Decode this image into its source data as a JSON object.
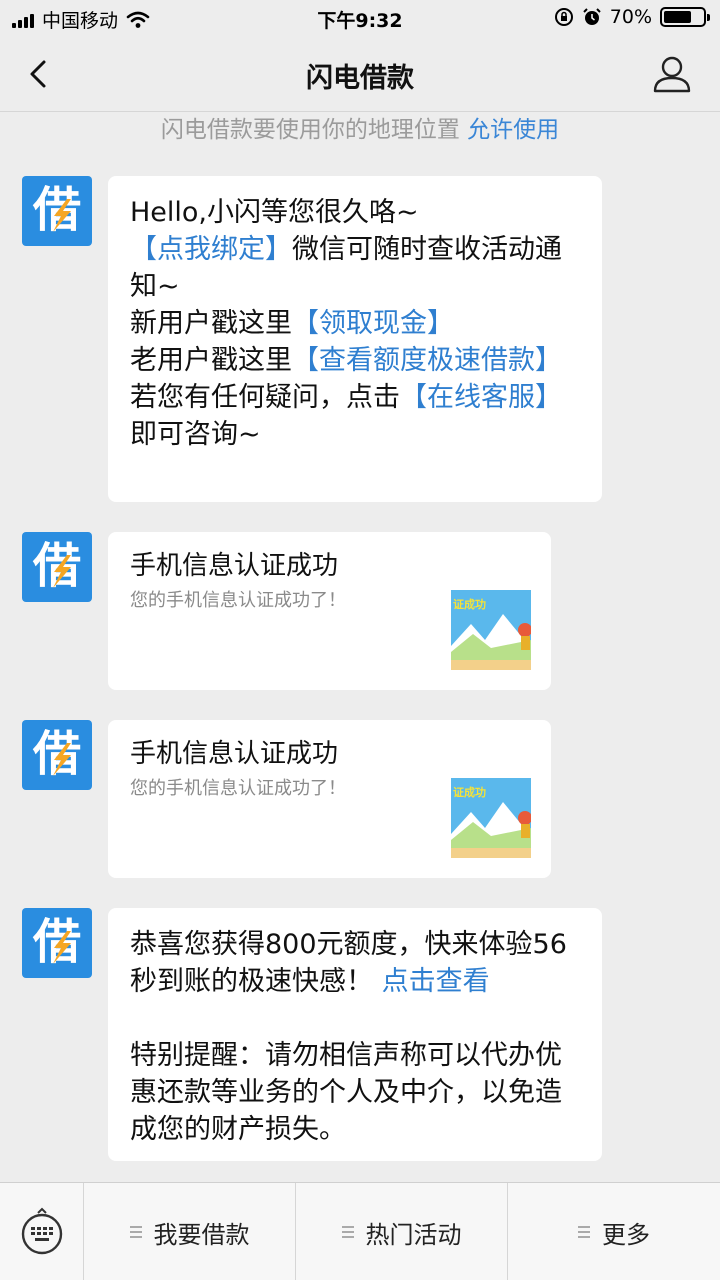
{
  "status_bar": {
    "carrier": "中国移动",
    "time": "下午9:32",
    "battery_percent": "70%",
    "battery_level": 0.7
  },
  "nav": {
    "title": "闪电借款",
    "back_icon": "chevron-left-icon",
    "user_icon": "user-profile-icon"
  },
  "location_tip": {
    "text": "闪电借款要使用你的地理位置",
    "action": "允许使用"
  },
  "avatar": {
    "char": "借",
    "color": "#2a8de0",
    "accent": "#f5a623"
  },
  "messages": {
    "welcome": {
      "line1": "Hello,小闪等您很久咯~",
      "link1": "【点我绑定】",
      "text1": "微信可随时查收活动通知~",
      "text2": "新用户戳这里",
      "link2": "【领取现金】",
      "text3": "老用户戳这里",
      "link3": "【查看额度极速借款】",
      "text4": "若您有任何疑问，点击",
      "link4": "【在线客服】",
      "text5": "即可咨询~"
    },
    "card1": {
      "title": "手机信息认证成功",
      "desc": "您的手机信息认证成功了！",
      "thumb_text": "证成功"
    },
    "card2": {
      "title": "手机信息认证成功",
      "desc": "您的手机信息认证成功了！",
      "thumb_text": "证成功"
    },
    "promo": {
      "text1": "恭喜您获得800元额度，快来体验56秒到账的极速快感！",
      "link": "点击查看",
      "text2": "特别提醒：请勿相信声称可以代办优惠还款等业务的个人及中介，以免造成您的财产损失。"
    }
  },
  "bottom_menu": {
    "keyboard_icon": "keyboard-icon",
    "items": [
      {
        "label": "我要借款"
      },
      {
        "label": "热门活动"
      },
      {
        "label": "更多"
      }
    ]
  },
  "colors": {
    "link": "#2f7fd0",
    "background": "#ededed",
    "bubble": "#ffffff"
  }
}
